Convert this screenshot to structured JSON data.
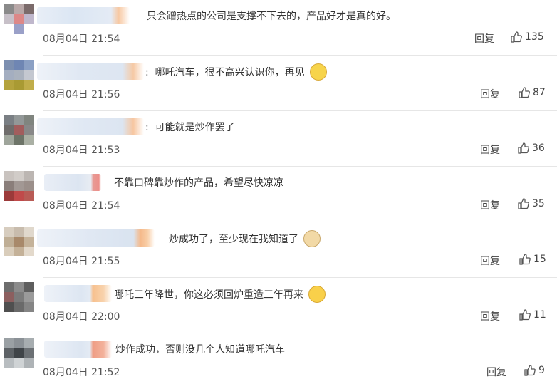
{
  "comments": [
    {
      "text": "只会蹭热点的公司是支撑不下去的，产品好才是真的好。",
      "time": "08月04日 21:54",
      "reply": "回复",
      "likes": "135",
      "emoji": ""
    },
    {
      "text": "哪吒汽车，很不高兴认识你，再见",
      "time": "08月04日 21:56",
      "reply": "回复",
      "likes": "87",
      "emoji": "shh-emoji"
    },
    {
      "text": "可能就是炒作罢了",
      "time": "08月04日 21:53",
      "reply": "回复",
      "likes": "36",
      "emoji": ""
    },
    {
      "text": "不靠口碑靠炒作的产品，希望尽快凉凉",
      "time": "08月04日 21:54",
      "reply": "回复",
      "likes": "35",
      "emoji": ""
    },
    {
      "text": "炒成功了，至少现在我知道了",
      "time": "08月04日 21:55",
      "reply": "回复",
      "likes": "15",
      "emoji": "doge-emoji"
    },
    {
      "text": "哪吒三年降世，你这必须回炉重造三年再来",
      "time": "08月04日 22:00",
      "reply": "回复",
      "likes": "11",
      "emoji": "laughing-tears-emoji"
    },
    {
      "text": "炒作成功，否则没几个人知道哪吒汽车",
      "time": "08月04日 21:52",
      "reply": "回复",
      "likes": "9",
      "emoji": ""
    }
  ]
}
